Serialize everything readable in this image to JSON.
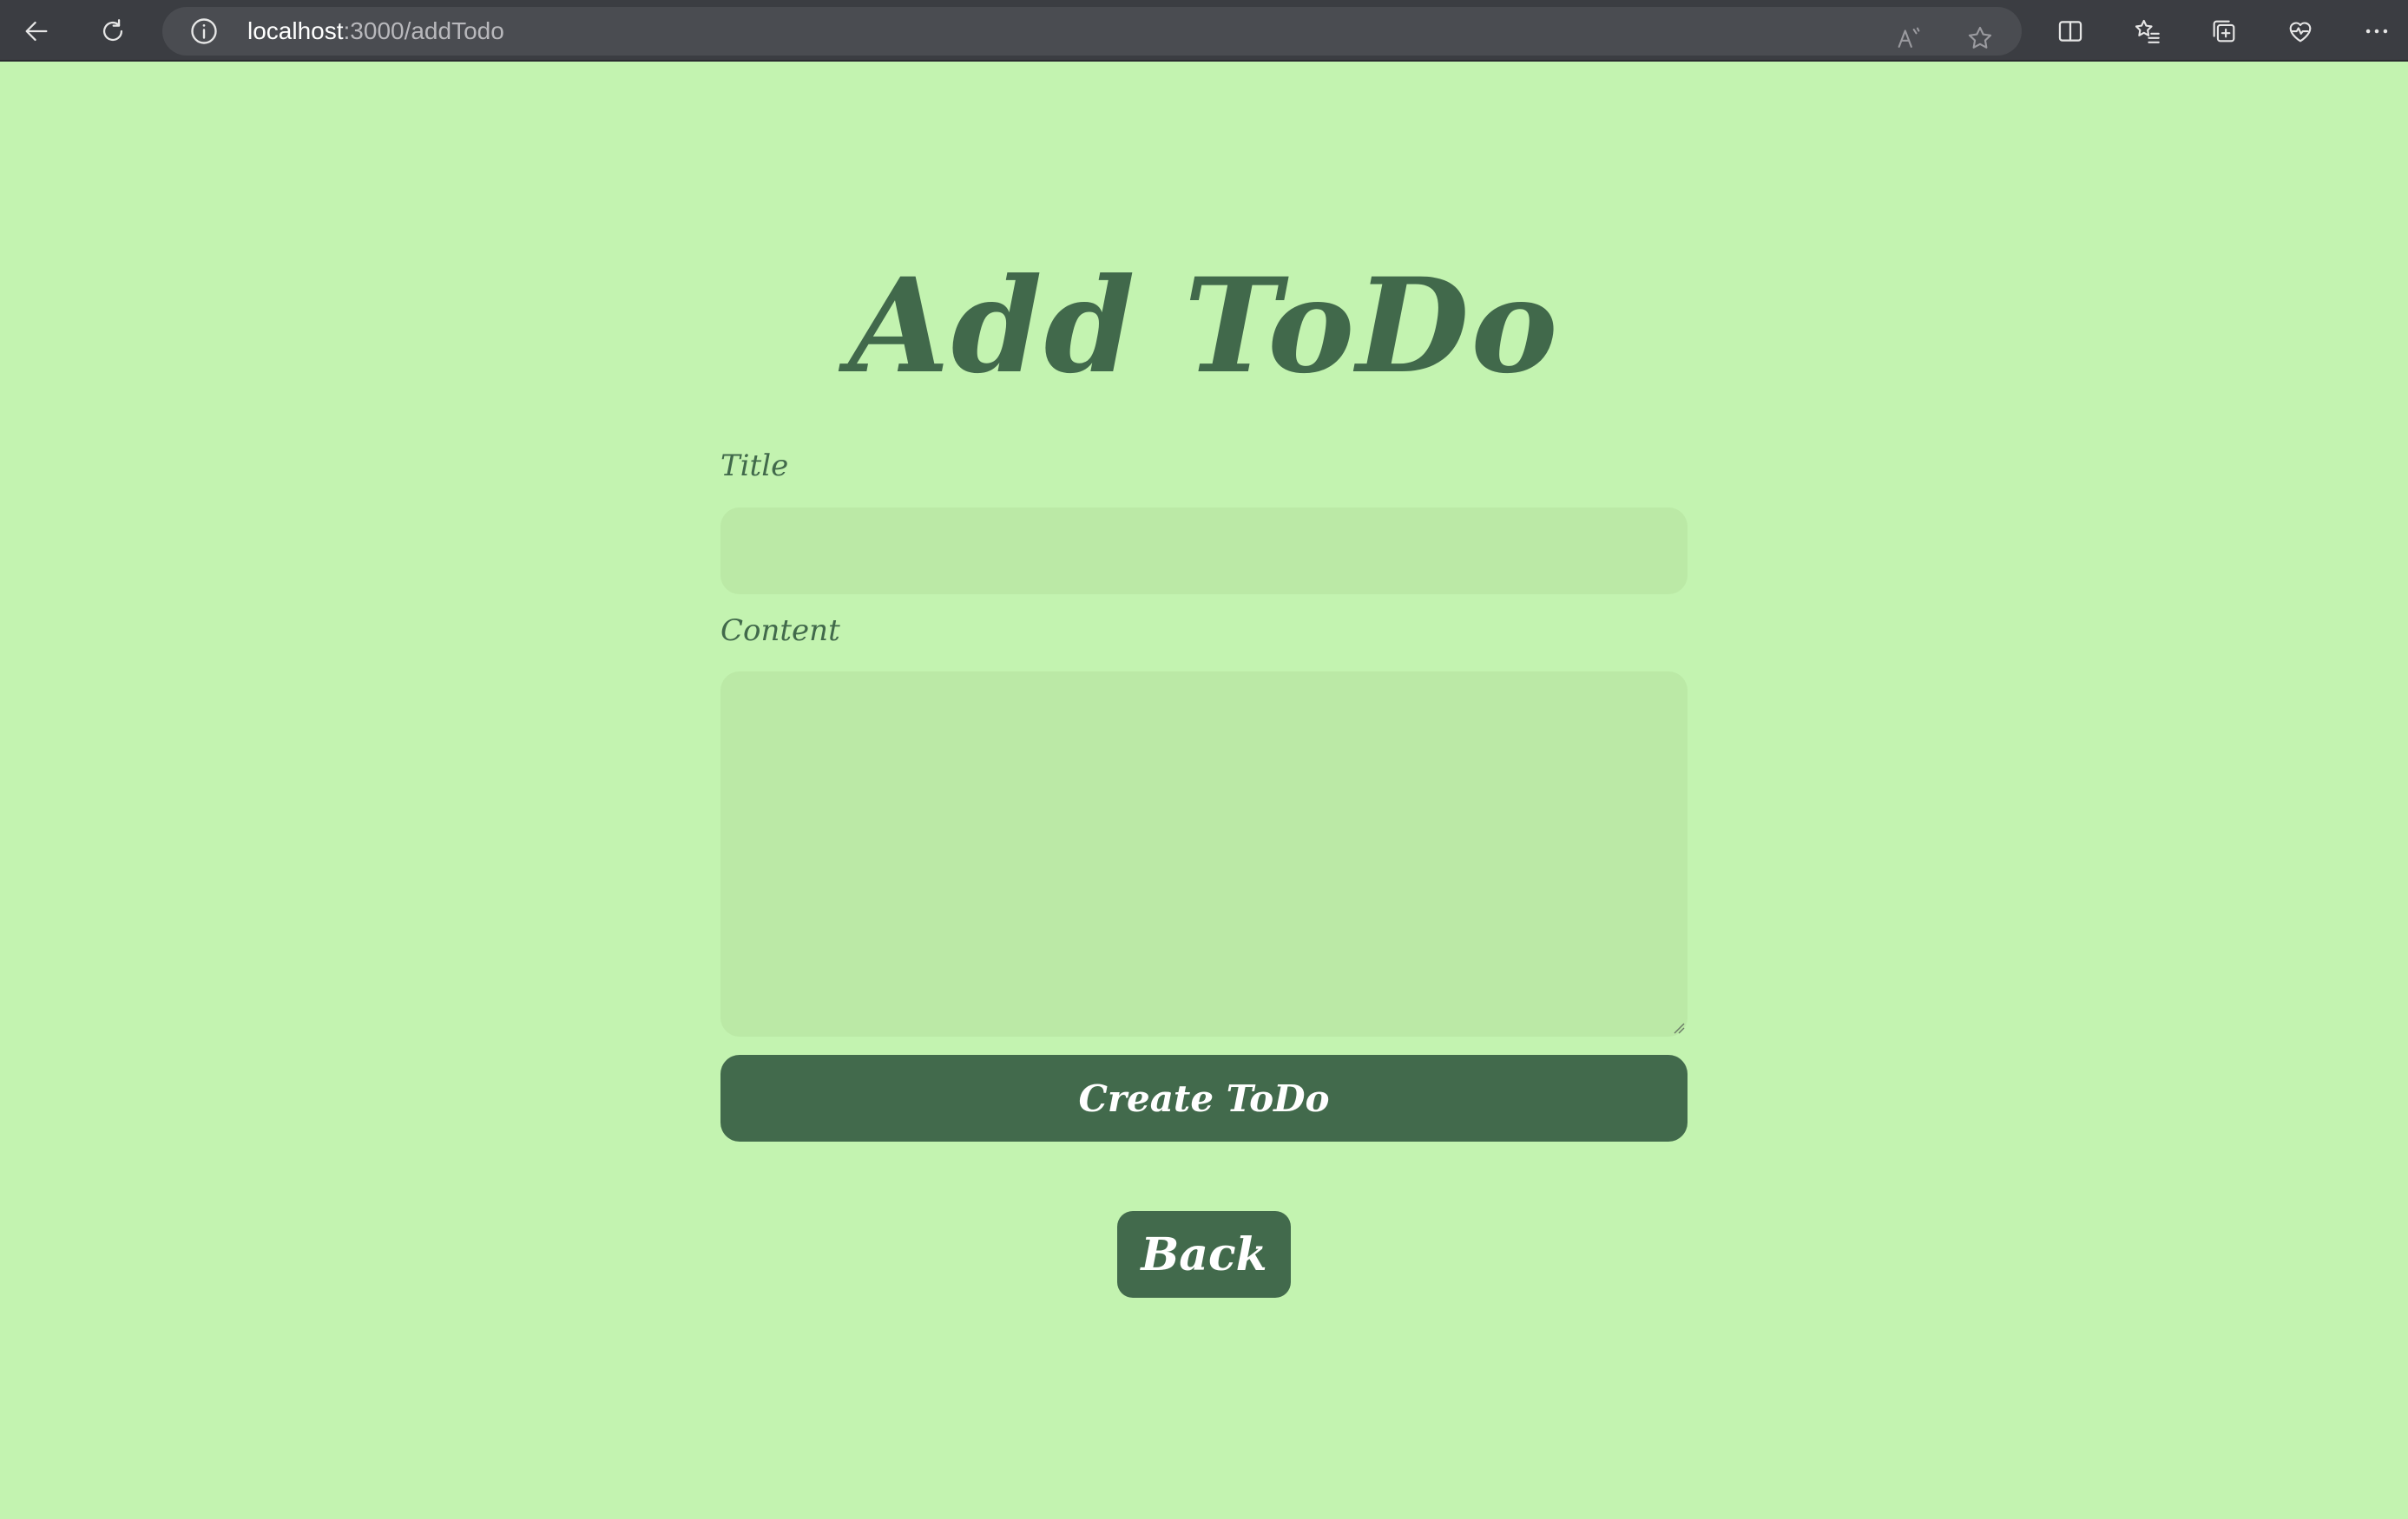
{
  "browser": {
    "url_host": "localhost",
    "url_path": ":3000/addTodo",
    "icons": {
      "back": "back-arrow-icon",
      "reload": "reload-icon",
      "info": "info-icon",
      "read_aloud": "read-aloud-icon",
      "favorite": "star-icon",
      "split_screen": "split-screen-icon",
      "favorites": "favorites-list-icon",
      "collections": "collections-icon",
      "health": "browser-essentials-icon",
      "more": "more-icon"
    }
  },
  "page": {
    "title": "Add ToDo",
    "title_label": "Title",
    "title_value": "",
    "content_label": "Content",
    "content_value": "",
    "create_button": "Create ToDo",
    "back_button": "Back"
  },
  "colors": {
    "background": "#c3f3b0",
    "input_bg": "#bbe9a6",
    "accent": "#426a4c",
    "button_text": "#ffffff"
  }
}
